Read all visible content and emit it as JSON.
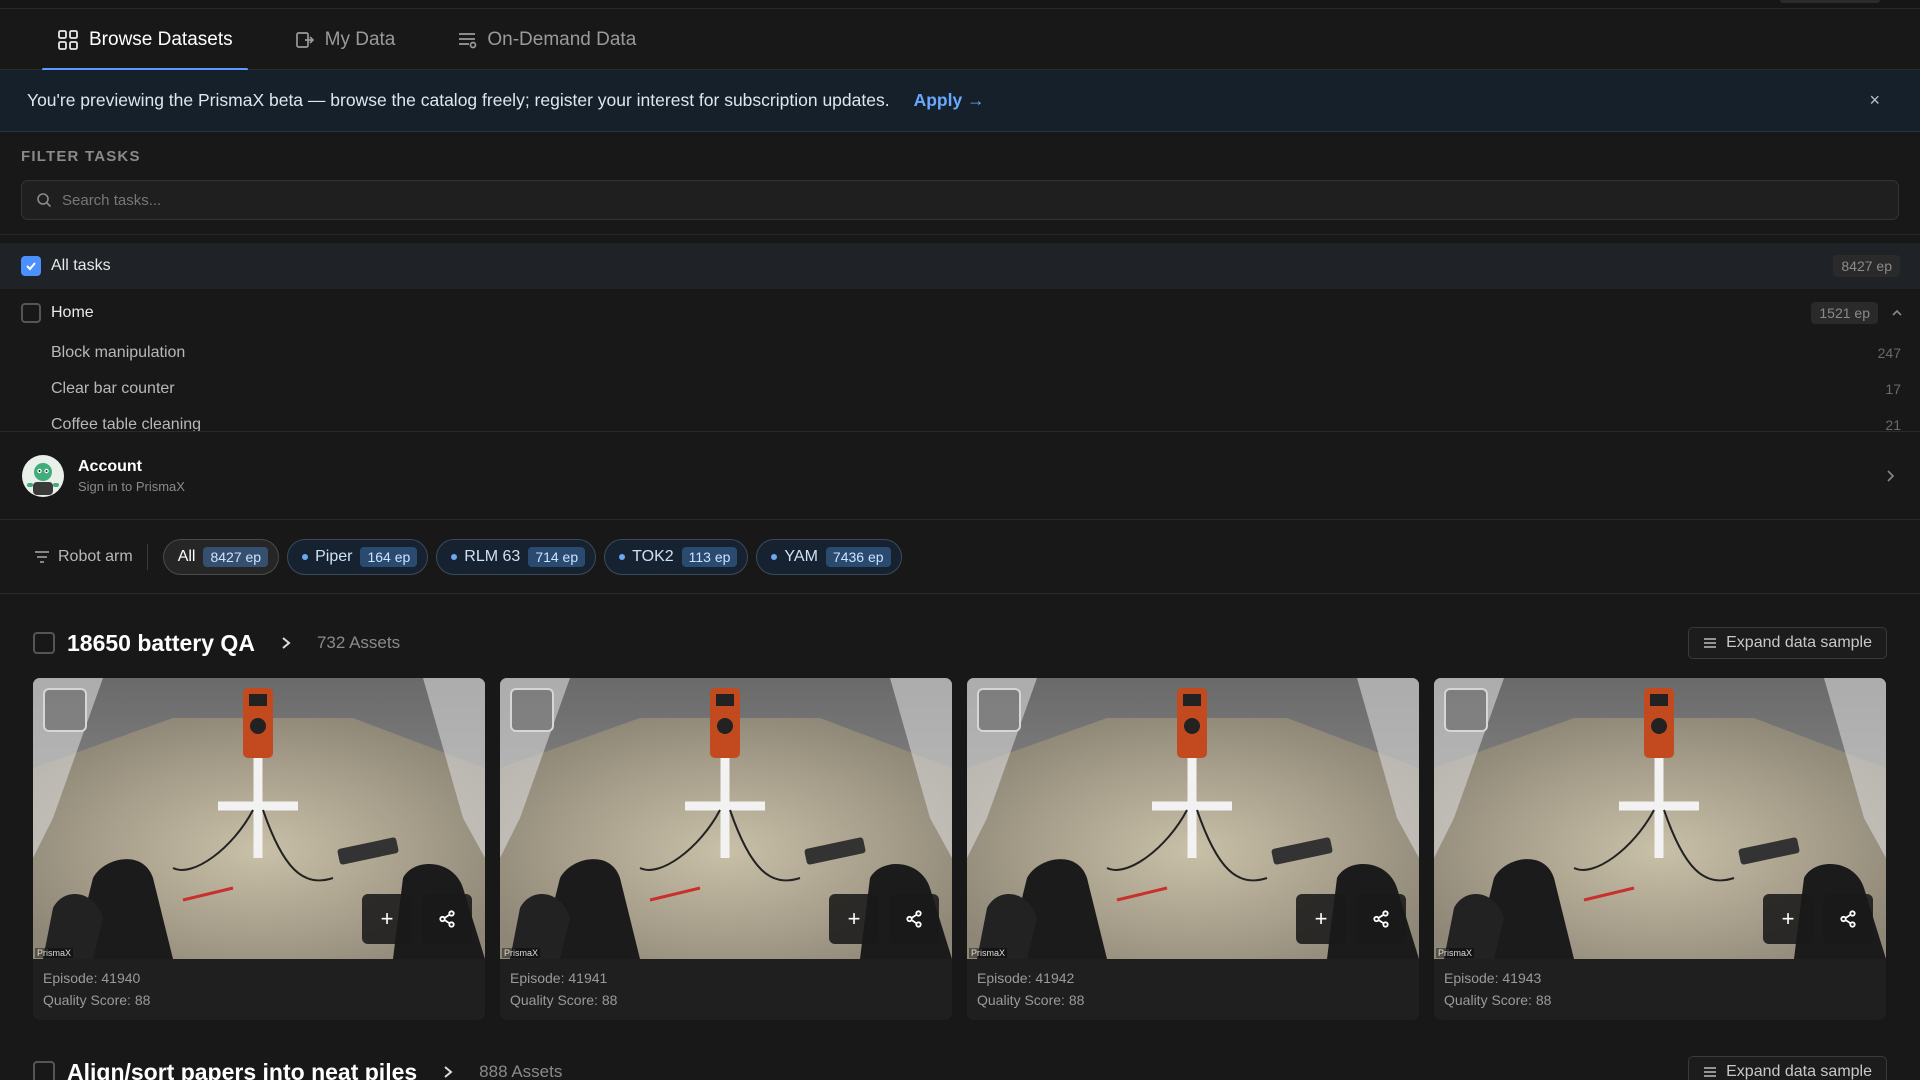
{
  "tabs": [
    {
      "label": "Browse Datasets",
      "active": true
    },
    {
      "label": "My Data",
      "active": false
    },
    {
      "label": "On-Demand Data",
      "active": false
    }
  ],
  "banner": {
    "text": "You're previewing the PrismaX beta — browse the catalog freely; register your interest for subscription updates.",
    "apply": "Apply →",
    "close": "×"
  },
  "filter": {
    "title": "FILTER TASKS",
    "search_placeholder": "Search tasks..."
  },
  "tasks": {
    "all": {
      "label": "All tasks",
      "count": "8427 ep",
      "checked": true
    },
    "home": {
      "label": "Home",
      "count": "1521 ep",
      "checked": false
    },
    "subtasks": [
      {
        "label": "Block manipulation",
        "count": "247"
      },
      {
        "label": "Clear bar counter",
        "count": "17"
      },
      {
        "label": "Coffee table cleaning",
        "count": "21"
      }
    ]
  },
  "account": {
    "title": "Account",
    "subtitle": "Sign in to PrismaX"
  },
  "robot_filter": {
    "label": "Robot arm",
    "chips": [
      {
        "label": "All",
        "count": "8427 ep"
      },
      {
        "label": "Piper",
        "count": "164 ep"
      },
      {
        "label": "RLM 63",
        "count": "714 ep"
      },
      {
        "label": "TOK2",
        "count": "113 ep"
      },
      {
        "label": "YAM",
        "count": "7436 ep"
      }
    ]
  },
  "datasets": [
    {
      "title": "18650 battery QA",
      "assets": "732 Assets",
      "expand": "Expand data sample",
      "episodes": [
        {
          "episode": "Episode: 41940",
          "quality": "Quality Score: 88"
        },
        {
          "episode": "Episode: 41941",
          "quality": "Quality Score: 88"
        },
        {
          "episode": "Episode: 41942",
          "quality": "Quality Score: 88"
        },
        {
          "episode": "Episode: 41943",
          "quality": "Quality Score: 88"
        }
      ]
    },
    {
      "title": "Align/sort papers into neat piles",
      "assets": "888 Assets",
      "expand": "Expand data sample"
    }
  ],
  "watermark": "PrismaX",
  "icons": {
    "tab_browse": "grid-icon",
    "tab_mydata": "folder-arrow-icon",
    "tab_ondemand": "list-icon",
    "search": "search-icon",
    "filter": "filter-lines-icon",
    "add": "plus-icon",
    "share": "share-icon"
  },
  "colors": {
    "accent": "#5b9bff",
    "banner_bg": "#15202b",
    "chip_bg": "#162230"
  }
}
